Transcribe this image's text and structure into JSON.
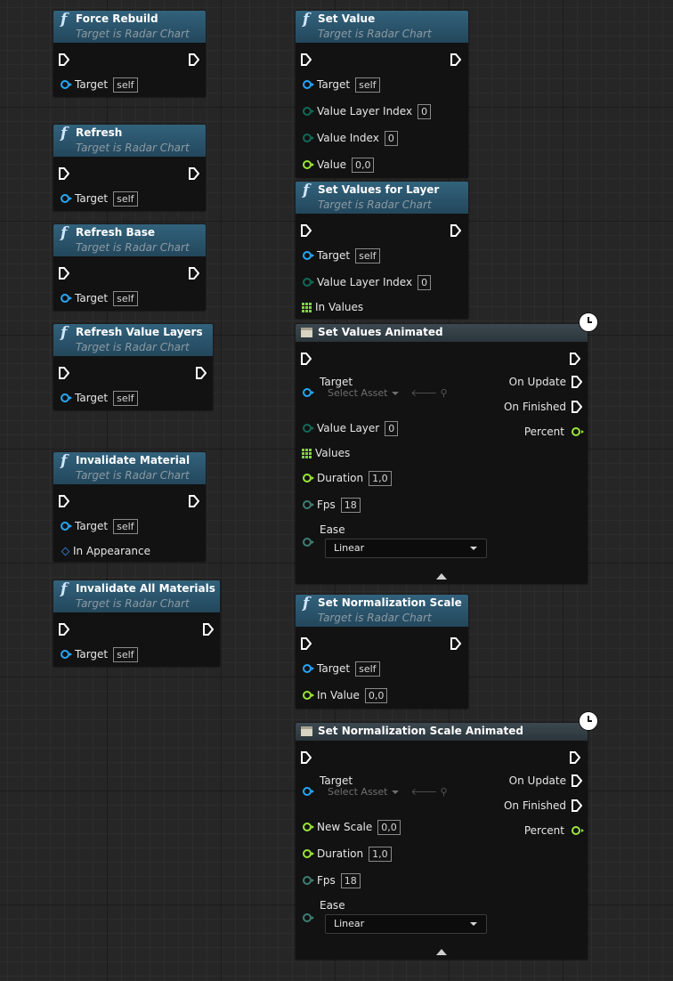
{
  "common": {
    "subtitle": "Target is Radar Chart",
    "target": "Target",
    "self": "self",
    "select_asset": "Select Asset",
    "asset_icons": "🡐 ⚲"
  },
  "nodes": {
    "force_rebuild": {
      "title": "Force Rebuild"
    },
    "refresh": {
      "title": "Refresh"
    },
    "refresh_base": {
      "title": "Refresh Base"
    },
    "refresh_value_layers": {
      "title": "Refresh Value Layers"
    },
    "invalidate_material": {
      "title": "Invalidate Material",
      "in_appearance": "In Appearance"
    },
    "invalidate_all_materials": {
      "title": "Invalidate All Materials"
    },
    "set_value": {
      "title": "Set Value",
      "value_layer_index": "Value Layer Index",
      "value_layer_index_val": "0",
      "value_index": "Value Index",
      "value_index_val": "0",
      "value": "Value",
      "value_val": "0,0"
    },
    "set_values_for_layer": {
      "title": "Set Values for Layer",
      "value_layer_index": "Value Layer Index",
      "value_layer_index_val": "0",
      "in_values": "In Values"
    },
    "set_values_animated": {
      "title": "Set Values Animated",
      "value_layer": "Value Layer",
      "value_layer_val": "0",
      "values": "Values",
      "duration": "Duration",
      "duration_val": "1,0",
      "fps": "Fps",
      "fps_val": "18",
      "ease": "Ease",
      "ease_val": "Linear",
      "on_update": "On Update",
      "on_finished": "On Finished",
      "percent": "Percent"
    },
    "set_normalization_scale": {
      "title": "Set Normalization Scale",
      "in_value": "In Value",
      "in_value_val": "0,0"
    },
    "set_normalization_scale_animated": {
      "title": "Set Normalization Scale Animated",
      "new_scale": "New Scale",
      "new_scale_val": "0,0",
      "duration": "Duration",
      "duration_val": "1,0",
      "fps": "Fps",
      "fps_val": "18",
      "ease": "Ease",
      "ease_val": "Linear",
      "on_update": "On Update",
      "on_finished": "On Finished",
      "percent": "Percent"
    }
  },
  "colors": {
    "header": "#2a5168",
    "node_body": "#121212",
    "object_pin": "#27a7f7",
    "float_pin": "#9be63a",
    "int_pin": "#1e8c7a",
    "array_pin": "#7fd24a"
  }
}
